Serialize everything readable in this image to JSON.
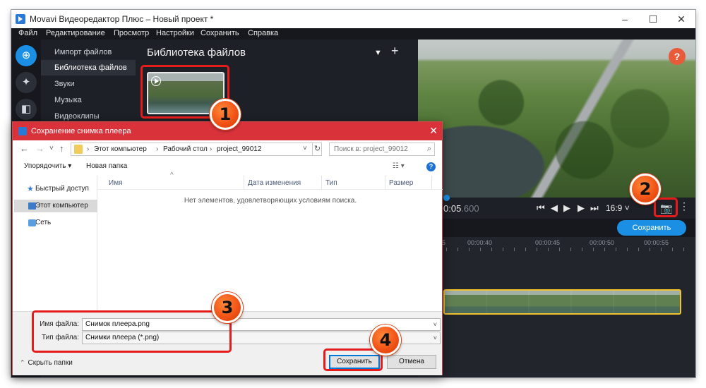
{
  "window": {
    "title": "Movavi Видеоредактор Плюс – Новый проект *",
    "minimize_glyph": "–",
    "maximize_glyph": "☐",
    "close_glyph": "✕"
  },
  "menu": [
    "Файл",
    "Редактирование",
    "Просмотр",
    "Настройки",
    "Сохранить",
    "Справка"
  ],
  "left_icons": [
    {
      "icon": "import-plus-icon",
      "glyph": "⊕"
    },
    {
      "icon": "magic-wand-icon",
      "glyph": "✦"
    },
    {
      "icon": "transitions-icon",
      "glyph": "◧"
    }
  ],
  "import_nav": {
    "items": [
      "Импорт файлов",
      "Библиотека файлов",
      "Звуки",
      "Музыка",
      "Видеоклипы"
    ],
    "active_index": 1
  },
  "library": {
    "title": "Библиотека файлов",
    "filter_glyph": "▼",
    "add_glyph": "+"
  },
  "preview": {
    "help_glyph": "?"
  },
  "player": {
    "timecode_main": "0:05",
    "timecode_ms": ".600",
    "controls": [
      "⏮",
      "◀",
      "▶",
      "▶",
      "⏭"
    ],
    "aspect": "16:9 ˅",
    "camera_glyph": "📷",
    "more_glyph": "⋮"
  },
  "export": {
    "label": "Сохранить"
  },
  "timeline": {
    "ruler_labels": [
      "5",
      "00:00:40",
      "00:00:45",
      "00:00:50",
      "00:00:55",
      "0"
    ]
  },
  "dialog": {
    "title": "Сохранение снимка плеера",
    "close_glyph": "✕",
    "nav_back": "←",
    "nav_forward": "→",
    "nav_dropdown": "˅",
    "nav_up": "↑",
    "path": [
      "Этот компьютер",
      "Рабочий стол",
      "project_99012"
    ],
    "path_sep": "›",
    "path_caret": "˅",
    "refresh_glyph": "↻",
    "search_placeholder": "Поиск в: project_99012",
    "search_glyph": "⌕",
    "toolbar": {
      "organize": "Упорядочить ▾",
      "new_folder": "Новая папка",
      "view_glyph": "☷ ▾",
      "help_glyph": "?"
    },
    "nav_pane": [
      {
        "label": "Быстрый доступ",
        "icon": "star-icon"
      },
      {
        "label": "Этот компьютер",
        "icon": "computer-icon"
      },
      {
        "label": "Сеть",
        "icon": "network-icon"
      }
    ],
    "nav_pane_active": 1,
    "columns": [
      "Имя",
      "Дата изменения",
      "Тип",
      "Размер"
    ],
    "sort_caret": "^",
    "empty_message": "Нет элементов, удовлетворяющих условиям поиска.",
    "filename_label": "Имя файла:",
    "filename_value": "Снимок плеера.png",
    "filetype_label": "Тип файла:",
    "filetype_value": "Снимки плеера (*.png)",
    "field_caret": "˅",
    "hide_folders": "Скрыть папки",
    "hide_folders_glyph": "⌃",
    "save_label": "Сохранить",
    "cancel_label": "Отмена"
  },
  "annotations": [
    "1",
    "2",
    "3",
    "4"
  ],
  "colors": {
    "accent": "#1a8fe3",
    "highlight": "#e41c1c",
    "badge": "#f25417",
    "dialog_title": "#d9323a",
    "clip_border": "#f2c232"
  }
}
